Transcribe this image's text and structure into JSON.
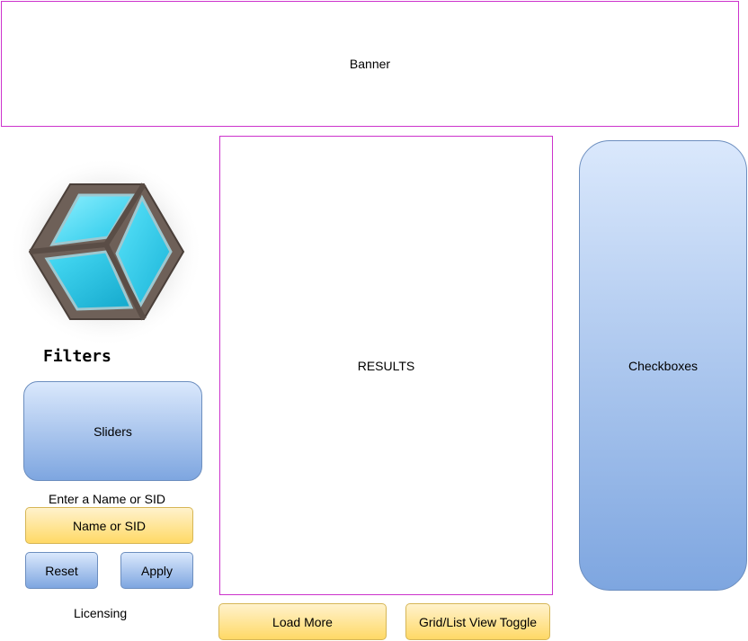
{
  "banner": {
    "label": "Banner"
  },
  "results": {
    "label": "RESULTS"
  },
  "checkboxes": {
    "label": "Checkboxes"
  },
  "filters": {
    "heading": "Filters",
    "sliders_label": "Sliders",
    "name_prompt": "Enter a Name or SID",
    "name_input_label": "Name or SID",
    "reset_label": "Reset",
    "apply_label": "Apply"
  },
  "footer": {
    "licensing_label": "Licensing",
    "load_more_label": "Load More",
    "view_toggle_label": "Grid/List View Toggle"
  },
  "logo": {
    "icon": "cube-icon"
  },
  "colors": {
    "wireframe_border": "#cc33cc",
    "blue_fill_top": "#dae8fc",
    "blue_fill_bottom": "#7ea6e0",
    "blue_stroke": "#6c8ebf",
    "yellow_fill_top": "#fff2cc",
    "yellow_fill_bottom": "#ffd966",
    "yellow_stroke": "#d6b656",
    "cube_frame": "#6e6058",
    "cube_glass": "#33d6f0"
  }
}
